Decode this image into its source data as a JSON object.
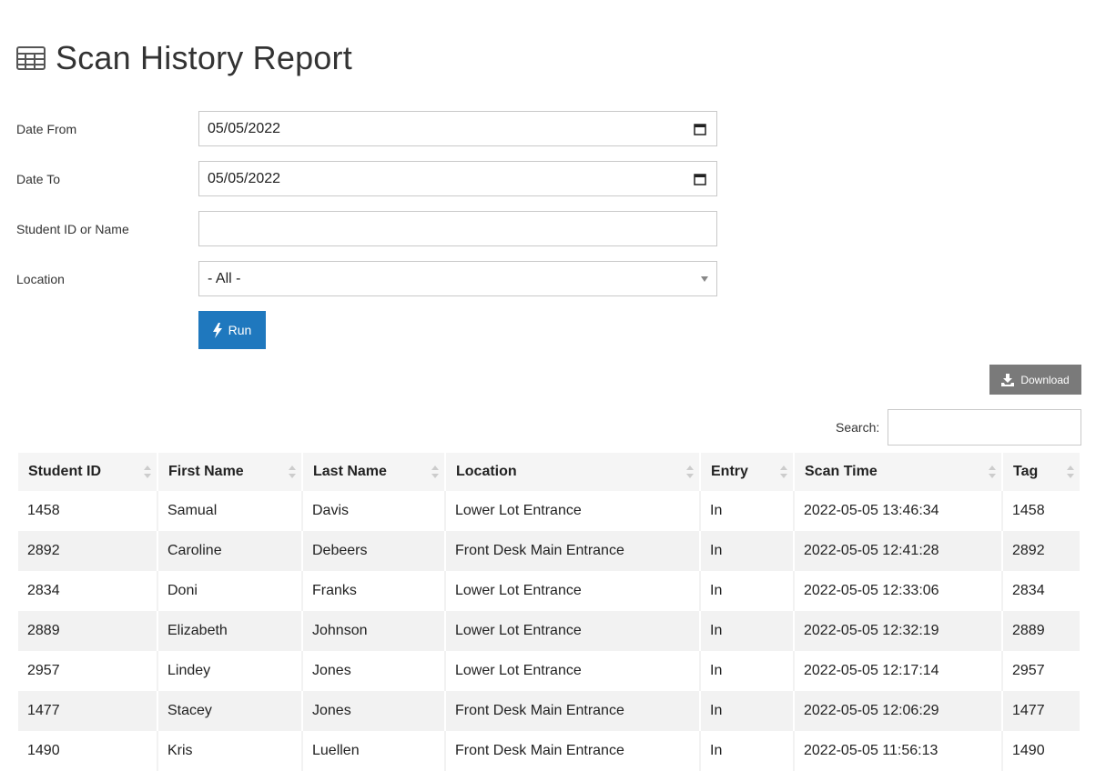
{
  "header": {
    "title": "Scan History Report",
    "icon": "table-icon"
  },
  "form": {
    "date_from": {
      "label": "Date From",
      "value": "05/05/2022"
    },
    "date_to": {
      "label": "Date To",
      "value": "05/05/2022"
    },
    "student": {
      "label": "Student ID or Name",
      "value": ""
    },
    "location": {
      "label": "Location",
      "value": "- All -"
    },
    "run_label": "Run"
  },
  "toolbar": {
    "download_label": "Download",
    "search_label": "Search:",
    "search_value": ""
  },
  "colors": {
    "primary": "#1f78be",
    "download": "#7a7a7a",
    "header_bg": "#f5f5f5",
    "stripe": "#f2f2f2"
  },
  "table": {
    "columns": [
      "Student ID",
      "First Name",
      "Last Name",
      "Location",
      "Entry",
      "Scan Time",
      "Tag"
    ],
    "rows": [
      [
        "1458",
        "Samual",
        "Davis",
        "Lower Lot Entrance",
        "In",
        "2022-05-05 13:46:34",
        "1458"
      ],
      [
        "2892",
        "Caroline",
        "Debeers",
        "Front Desk Main Entrance",
        "In",
        "2022-05-05 12:41:28",
        "2892"
      ],
      [
        "2834",
        "Doni",
        "Franks",
        "Lower Lot Entrance",
        "In",
        "2022-05-05 12:33:06",
        "2834"
      ],
      [
        "2889",
        "Elizabeth",
        "Johnson",
        "Lower Lot Entrance",
        "In",
        "2022-05-05 12:32:19",
        "2889"
      ],
      [
        "2957",
        "Lindey",
        "Jones",
        "Lower Lot Entrance",
        "In",
        "2022-05-05 12:17:14",
        "2957"
      ],
      [
        "1477",
        "Stacey",
        "Jones",
        "Front Desk Main Entrance",
        "In",
        "2022-05-05 12:06:29",
        "1477"
      ],
      [
        "1490",
        "Kris",
        "Luellen",
        "Front Desk Main Entrance",
        "In",
        "2022-05-05 11:56:13",
        "1490"
      ]
    ]
  }
}
